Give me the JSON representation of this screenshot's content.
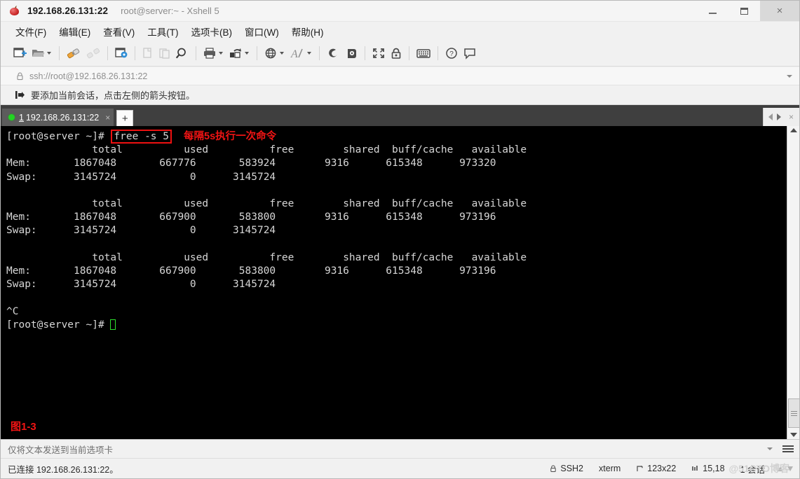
{
  "window": {
    "address_title": "192.168.26.131:22",
    "subtitle": "root@server:~ - Xshell 5",
    "minimize_label": "最小化",
    "maximize_label": "最大化",
    "close_label": "×"
  },
  "menu": {
    "items": [
      {
        "label": "文件(F)"
      },
      {
        "label": "编辑(E)"
      },
      {
        "label": "查看(V)"
      },
      {
        "label": "工具(T)"
      },
      {
        "label": "选项卡(B)"
      },
      {
        "label": "窗口(W)"
      },
      {
        "label": "帮助(H)"
      }
    ]
  },
  "toolbar": {
    "items": [
      {
        "name": "new-session-icon",
        "caret": false
      },
      {
        "name": "open-folder-icon",
        "caret": true
      },
      {
        "name": "connect-icon",
        "caret": false
      },
      {
        "name": "disconnect-icon",
        "caret": false
      },
      {
        "name": "session-properties-icon",
        "caret": false
      },
      {
        "name": "copy-icon",
        "caret": false
      },
      {
        "name": "paste-icon",
        "caret": false
      },
      {
        "name": "find-icon",
        "caret": false
      },
      {
        "name": "print-icon",
        "caret": true
      },
      {
        "name": "file-transfer-icon",
        "caret": true
      },
      {
        "name": "globe-icon",
        "caret": true
      },
      {
        "name": "font-icon",
        "caret": true
      },
      {
        "name": "ssh-tunnel-icon",
        "caret": false
      },
      {
        "name": "key-manager-icon",
        "caret": false
      },
      {
        "name": "fullscreen-icon",
        "caret": false
      },
      {
        "name": "lock-icon",
        "caret": false
      },
      {
        "name": "keyboard-icon",
        "caret": false
      },
      {
        "name": "help-icon",
        "caret": false
      },
      {
        "name": "feedback-icon",
        "caret": false
      }
    ]
  },
  "address_bar": {
    "value": "ssh://root@192.168.26.131:22",
    "placeholder": "ssh://"
  },
  "hint_bar": {
    "text": "要添加当前会话，点击左侧的箭头按钮。"
  },
  "tabs": {
    "items": [
      {
        "index": "1",
        "label": "192.168.26.131:22",
        "close": "×",
        "connected": true
      }
    ],
    "add_label": "+",
    "nav_close": "×"
  },
  "terminal": {
    "prompt": "[root@server ~]#",
    "command": "free -s 5",
    "annotation": "每隔5s执行一次命令",
    "columns": [
      "total",
      "used",
      "free",
      "shared",
      "buff/cache",
      "available"
    ],
    "blocks": [
      {
        "mem": {
          "label": "Mem:",
          "total": "1867048",
          "used": "667776",
          "free": "583924",
          "shared": "9316",
          "buff_cache": "615348",
          "available": "973320"
        },
        "swap": {
          "label": "Swap:",
          "total": "3145724",
          "used": "0",
          "free": "3145724"
        }
      },
      {
        "mem": {
          "label": "Mem:",
          "total": "1867048",
          "used": "667900",
          "free": "583800",
          "shared": "9316",
          "buff_cache": "615348",
          "available": "973196"
        },
        "swap": {
          "label": "Swap:",
          "total": "3145724",
          "used": "0",
          "free": "3145724"
        }
      },
      {
        "mem": {
          "label": "Mem:",
          "total": "1867048",
          "used": "667900",
          "free": "583800",
          "shared": "9316",
          "buff_cache": "615348",
          "available": "973196"
        },
        "swap": {
          "label": "Swap:",
          "total": "3145724",
          "used": "0",
          "free": "3145724"
        }
      }
    ],
    "interrupt": "^C",
    "final_prompt": "[root@server ~]#",
    "figure_caption": "图1-3"
  },
  "send_bar": {
    "text": "仅将文本发送到当前选项卡"
  },
  "status_bar": {
    "connection": "已连接 192.168.26.131:22。",
    "protocol": "SSH2",
    "terminal_type": "xterm",
    "size": "123x22",
    "cursor_position": "15,18",
    "sessions": "1 会话",
    "watermark": "@51CTO博客"
  },
  "colors": {
    "accent_red": "#ee1111",
    "terminal_bg": "#000000",
    "terminal_fg": "#d6d6d6",
    "cursor_green": "#2ee02e",
    "tab_active_bg": "#5c5c5c"
  }
}
